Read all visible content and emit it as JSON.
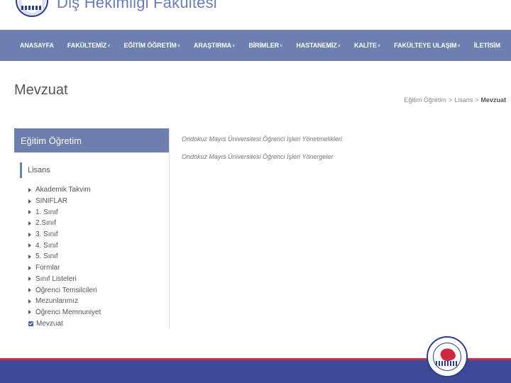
{
  "header": {
    "title": "Diş Hekimliği Fakültesi"
  },
  "nav": {
    "items": [
      {
        "label": "ANASAYFA",
        "caret": ""
      },
      {
        "label": "FAKÜLTEMİZ",
        "caret": "v"
      },
      {
        "label": "EĞİTİM ÖĞRETİM",
        "caret": "v"
      },
      {
        "label": "ARAŞTIRMA",
        "caret": "v"
      },
      {
        "label": "BİRİMLER",
        "caret": "v"
      },
      {
        "label": "HASTANEMİZ",
        "caret": "v"
      },
      {
        "label": "KALİTE",
        "caret": "v"
      },
      {
        "label": "FAKÜLTEYE ULAŞIM",
        "caret": "v"
      },
      {
        "label": "İLETİSİM",
        "caret": ""
      }
    ]
  },
  "page": {
    "title": "Mevzuat"
  },
  "breadcrumb": {
    "items": [
      "Eğitim Öğretim",
      "Lisans",
      "Mevzuat"
    ],
    "separator": ">"
  },
  "sidebar": {
    "header": "Eğitim Öğretim",
    "group": "Lisans",
    "items": [
      "Akademik Takvim",
      "SINIFLAR",
      "1. Sınıf",
      "2.Sınıf",
      "3. Sınıf",
      "4. Sınıf",
      "5. Sınıf",
      "Formlar",
      "Sınıf Listeleri",
      "Öğrenci Temsilcileri",
      "Mezunlarımız",
      "Öğrenci Memnuniyet",
      "Mevzuat"
    ]
  },
  "content": {
    "links": [
      "Ondokuz Mayıs Üniversitesi Öğrenci İşleri Yönetmelikleri",
      "Ondokuz Mayıs Üniversitesi Öğrenci İşleri Yönergeler"
    ]
  },
  "colors": {
    "nav": "#6c7fae",
    "footer_band": "#3c4a98",
    "footer_line": "#d0283e"
  }
}
